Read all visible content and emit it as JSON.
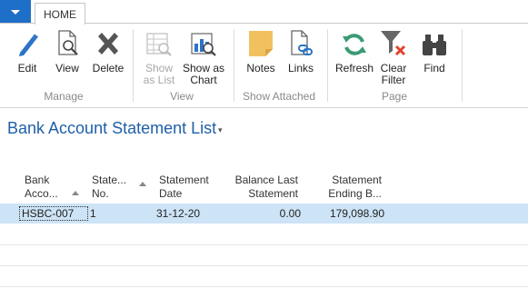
{
  "tabs": {
    "home": "HOME"
  },
  "ribbon": {
    "groups": {
      "manage": "Manage",
      "view": "View",
      "show_attached": "Show Attached",
      "page": "Page"
    },
    "buttons": {
      "edit": "Edit",
      "view": "View",
      "delete": "Delete",
      "show_as_list_1": "Show",
      "show_as_list_2": "as List",
      "show_as_chart_1": "Show as",
      "show_as_chart_2": "Chart",
      "notes": "Notes",
      "links": "Links",
      "refresh": "Refresh",
      "clear_filter_1": "Clear",
      "clear_filter_2": "Filter",
      "find": "Find"
    }
  },
  "page": {
    "title": "Bank Account Statement List",
    "title_caret": "▾"
  },
  "table": {
    "headers": {
      "bank_account_1": "Bank",
      "bank_account_2": "Acco...",
      "statement_no_1": "State...",
      "statement_no_2": "No.",
      "statement_date_1": "Statement",
      "statement_date_2": "Date",
      "balance_last_1": "Balance Last",
      "balance_last_2": "Statement",
      "ending_1": "Statement",
      "ending_2": "Ending B..."
    },
    "rows": [
      {
        "bank_account": "HSBC-007",
        "statement_no": "1",
        "statement_date": "31-12-20",
        "balance_last": "0.00",
        "ending_balance": "179,098.90"
      }
    ]
  },
  "colors": {
    "accent": "#1e6fc8",
    "title": "#1f5fa8",
    "selected_row": "#cde3f6"
  }
}
